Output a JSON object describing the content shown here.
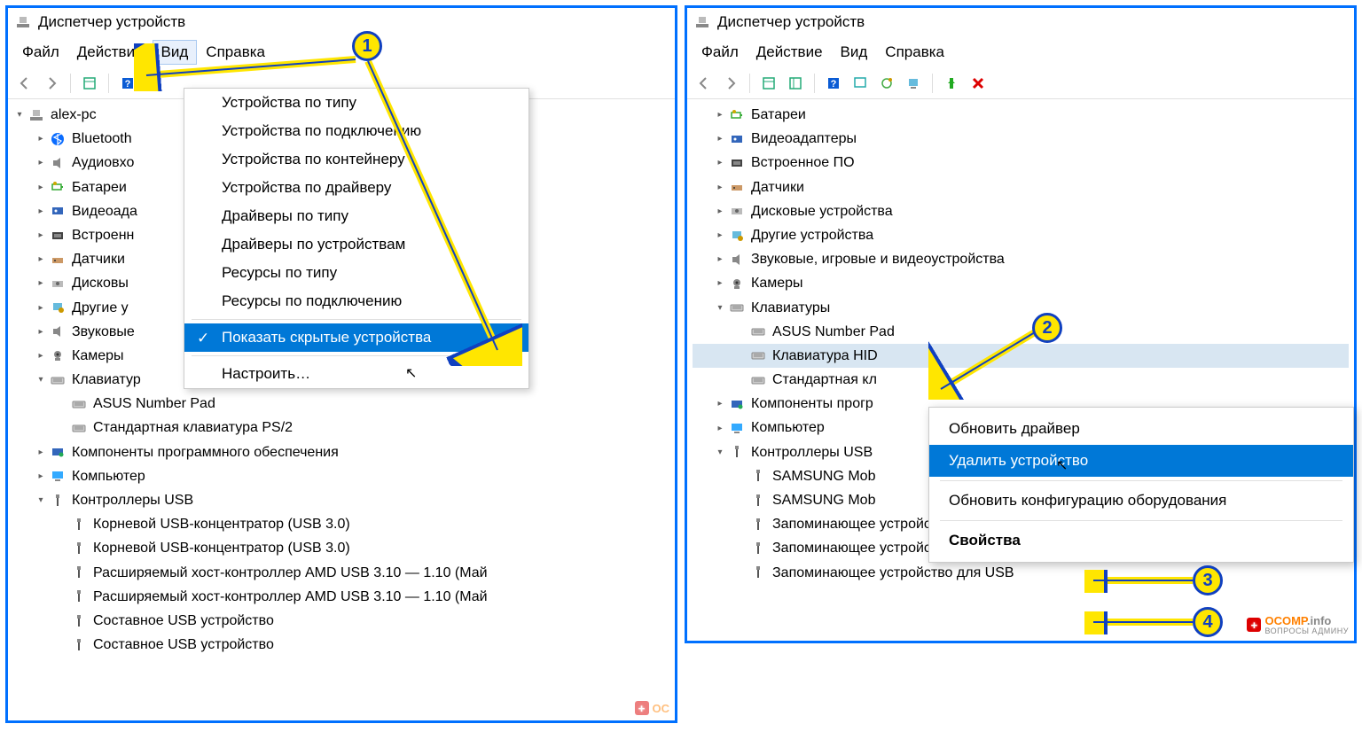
{
  "markers": [
    "1",
    "2",
    "3",
    "4"
  ],
  "left": {
    "title": "Диспетчер устройств",
    "menubar": [
      "Файл",
      "Действие",
      "Вид",
      "Справка"
    ],
    "active_menu_index": 2,
    "view_menu": {
      "items": [
        "Устройства по типу",
        "Устройства по подключению",
        "Устройства по контейнеру",
        "Устройства по драйверу",
        "Драйверы по типу",
        "Драйверы по устройствам",
        "Ресурсы по типу",
        "Ресурсы по подключению",
        "Показать скрытые устройства",
        "Настроить…"
      ],
      "selected_index": 8,
      "checked_index": 8,
      "sep_before": [
        8,
        9
      ]
    },
    "tree": [
      {
        "d": 0,
        "chev": "v",
        "icon": "pc",
        "label": "alex-pc"
      },
      {
        "d": 1,
        "chev": ">",
        "icon": "bt",
        "label": "Bluetooth"
      },
      {
        "d": 1,
        "chev": ">",
        "icon": "audio",
        "label": "Аудиовхо"
      },
      {
        "d": 1,
        "chev": ">",
        "icon": "bat",
        "label": "Батареи"
      },
      {
        "d": 1,
        "chev": ">",
        "icon": "vid",
        "label": "Видеоада"
      },
      {
        "d": 1,
        "chev": ">",
        "icon": "fw",
        "label": "Встроенн"
      },
      {
        "d": 1,
        "chev": ">",
        "icon": "sens",
        "label": "Датчики"
      },
      {
        "d": 1,
        "chev": ">",
        "icon": "disk",
        "label": "Дисковы"
      },
      {
        "d": 1,
        "chev": ">",
        "icon": "other",
        "label": "Другие у"
      },
      {
        "d": 1,
        "chev": ">",
        "icon": "audio",
        "label": "Звуковые"
      },
      {
        "d": 1,
        "chev": ">",
        "icon": "cam",
        "label": "Камеры"
      },
      {
        "d": 1,
        "chev": "v",
        "icon": "kbd",
        "label": "Клавиатур"
      },
      {
        "d": 2,
        "chev": "",
        "icon": "kbd",
        "label": "ASUS Number Pad"
      },
      {
        "d": 2,
        "chev": "",
        "icon": "kbd",
        "label": "Стандартная клавиатура PS/2"
      },
      {
        "d": 1,
        "chev": ">",
        "icon": "sw",
        "label": "Компоненты программного обеспечения"
      },
      {
        "d": 1,
        "chev": ">",
        "icon": "mon",
        "label": "Компьютер"
      },
      {
        "d": 1,
        "chev": "v",
        "icon": "usb",
        "label": "Контроллеры USB"
      },
      {
        "d": 2,
        "chev": "",
        "icon": "usb",
        "label": "Корневой USB-концентратор (USB 3.0)"
      },
      {
        "d": 2,
        "chev": "",
        "icon": "usb",
        "label": "Корневой USB-концентратор (USB 3.0)"
      },
      {
        "d": 2,
        "chev": "",
        "icon": "usb",
        "label": "Расширяемый хост-контроллер AMD USB 3.10 — 1.10 (Май"
      },
      {
        "d": 2,
        "chev": "",
        "icon": "usb",
        "label": "Расширяемый хост-контроллер AMD USB 3.10 — 1.10 (Май"
      },
      {
        "d": 2,
        "chev": "",
        "icon": "usb",
        "label": "Составное USB устройство"
      },
      {
        "d": 2,
        "chev": "",
        "icon": "usb",
        "label": "Составное USB устройство"
      }
    ]
  },
  "right": {
    "title": "Диспетчер устройств",
    "menubar": [
      "Файл",
      "Действие",
      "Вид",
      "Справка"
    ],
    "toolbar_extra": true,
    "tree": [
      {
        "d": 1,
        "chev": ">",
        "icon": "bat",
        "label": "Батареи"
      },
      {
        "d": 1,
        "chev": ">",
        "icon": "vid",
        "label": "Видеоадаптеры"
      },
      {
        "d": 1,
        "chev": ">",
        "icon": "fw",
        "label": "Встроенное ПО"
      },
      {
        "d": 1,
        "chev": ">",
        "icon": "sens",
        "label": "Датчики"
      },
      {
        "d": 1,
        "chev": ">",
        "icon": "disk",
        "label": "Дисковые устройства"
      },
      {
        "d": 1,
        "chev": ">",
        "icon": "other",
        "label": "Другие устройства"
      },
      {
        "d": 1,
        "chev": ">",
        "icon": "audio",
        "label": "Звуковые, игровые и видеоустройства"
      },
      {
        "d": 1,
        "chev": ">",
        "icon": "cam",
        "label": "Камеры"
      },
      {
        "d": 1,
        "chev": "v",
        "icon": "kbd",
        "label": "Клавиатуры"
      },
      {
        "d": 2,
        "chev": "",
        "icon": "kbd",
        "label": "ASUS Number Pad"
      },
      {
        "d": 2,
        "chev": "",
        "icon": "kbd",
        "label": "Клавиатура HID",
        "selected": true
      },
      {
        "d": 2,
        "chev": "",
        "icon": "kbd",
        "label": "Стандартная кл"
      },
      {
        "d": 1,
        "chev": ">",
        "icon": "sw",
        "label": "Компоненты прогр"
      },
      {
        "d": 1,
        "chev": ">",
        "icon": "mon",
        "label": "Компьютер"
      },
      {
        "d": 1,
        "chev": "v",
        "icon": "usb",
        "label": "Контроллеры USB"
      },
      {
        "d": 2,
        "chev": "",
        "icon": "usb",
        "label": "SAMSUNG Mob"
      },
      {
        "d": 2,
        "chev": "",
        "icon": "usb",
        "label": "SAMSUNG Mob"
      },
      {
        "d": 2,
        "chev": "",
        "icon": "usb",
        "label": "Запоминающее устройство для USB"
      },
      {
        "d": 2,
        "chev": "",
        "icon": "usb",
        "label": "Запоминающее устройство для USB"
      },
      {
        "d": 2,
        "chev": "",
        "icon": "usb",
        "label": "Запоминающее устройство для USB"
      }
    ],
    "context_menu": {
      "items": [
        {
          "label": "Обновить драйвер"
        },
        {
          "label": "Удалить устройство",
          "selected": true
        },
        {
          "sep": true
        },
        {
          "label": "Обновить конфигурацию оборудования"
        },
        {
          "sep": true
        },
        {
          "label": "Свойства",
          "bold": true
        }
      ]
    }
  },
  "watermark": {
    "brand": "OCOMP",
    "tld": ".info",
    "sub": "ВОПРОСЫ АДМИНУ"
  }
}
